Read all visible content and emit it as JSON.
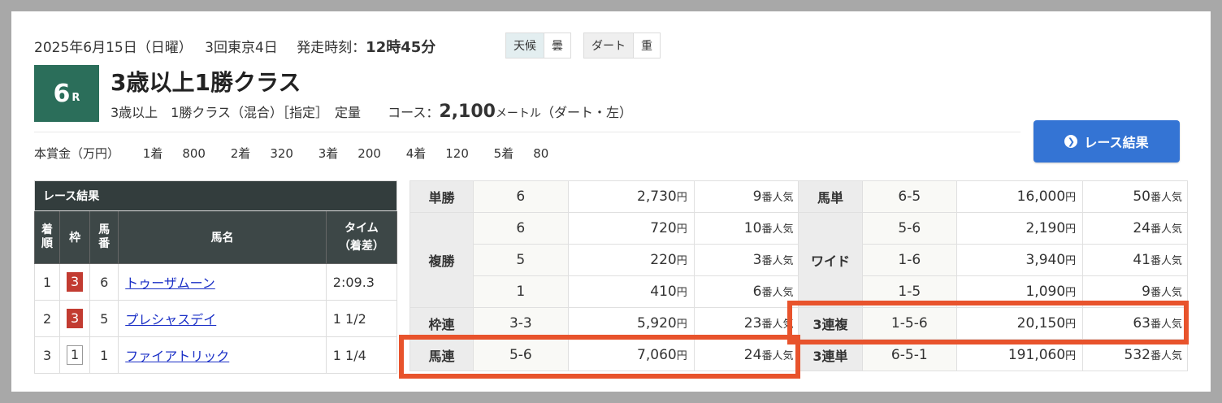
{
  "header": {
    "date": "2025年6月15日（日曜）",
    "meeting": "3回東京4日",
    "start_label": "発走時刻：",
    "start_time": "12時45分",
    "weather_label": "天候",
    "weather_value": "曇",
    "track_label": "ダート",
    "track_value": "重"
  },
  "race": {
    "number": "6",
    "r_suffix": "R",
    "title": "3歳以上1勝クラス",
    "conditions": "3歳以上　1勝クラス（混合）［指定］　定量",
    "course_label": "コース：",
    "distance": "2,100",
    "distance_unit": "メートル",
    "course_detail": "（ダート・左）"
  },
  "prize": {
    "label": "本賞金（万円）",
    "items": [
      {
        "place": "1着",
        "value": "800"
      },
      {
        "place": "2着",
        "value": "320"
      },
      {
        "place": "3着",
        "value": "200"
      },
      {
        "place": "4着",
        "value": "120"
      },
      {
        "place": "5着",
        "value": "80"
      }
    ]
  },
  "result_button": "レース結果",
  "results": {
    "caption": "レース結果",
    "headers": [
      "着順",
      "枠",
      "馬番",
      "馬名",
      "タイム（着差）"
    ],
    "rows": [
      {
        "rank": "1",
        "waku": "3",
        "waku_color": "#c23b31",
        "num": "6",
        "name": "トゥーザムーン",
        "time": "2:09.3"
      },
      {
        "rank": "2",
        "waku": "3",
        "waku_color": "#c23b31",
        "num": "5",
        "name": "プレシャスデイ",
        "time": "1 1/2"
      },
      {
        "rank": "3",
        "waku": "1",
        "waku_color": "#ffffff",
        "num": "1",
        "name": "ファイアトリック",
        "time": "1 1/4"
      }
    ]
  },
  "payouts": {
    "yen": "円",
    "ninki": "番人気",
    "tansho": {
      "label": "単勝",
      "combo": "6",
      "amount": "2,730",
      "pop": "9"
    },
    "fukusho": {
      "label": "複勝",
      "rows": [
        {
          "combo": "6",
          "amount": "720",
          "pop": "10"
        },
        {
          "combo": "5",
          "amount": "220",
          "pop": "3"
        },
        {
          "combo": "1",
          "amount": "410",
          "pop": "6"
        }
      ]
    },
    "wakuren": {
      "label": "枠連",
      "combo": "3-3",
      "amount": "5,920",
      "pop": "23"
    },
    "umaren": {
      "label": "馬連",
      "combo": "5-6",
      "amount": "7,060",
      "pop": "24"
    },
    "umatan": {
      "label": "馬単",
      "combo": "6-5",
      "amount": "16,000",
      "pop": "50"
    },
    "wide": {
      "label": "ワイド",
      "rows": [
        {
          "combo": "5-6",
          "amount": "2,190",
          "pop": "24"
        },
        {
          "combo": "1-6",
          "amount": "3,940",
          "pop": "41"
        },
        {
          "combo": "1-5",
          "amount": "1,090",
          "pop": "9"
        }
      ]
    },
    "sanrenpuku": {
      "label": "3連複",
      "combo": "1-5-6",
      "amount": "20,150",
      "pop": "63"
    },
    "sanrentan": {
      "label": "3連単",
      "combo": "6-5-1",
      "amount": "191,060",
      "pop": "532"
    }
  },
  "colors": {
    "highlight": "#e8532c",
    "badge": "#2b6e5a",
    "button": "#3474d4"
  }
}
